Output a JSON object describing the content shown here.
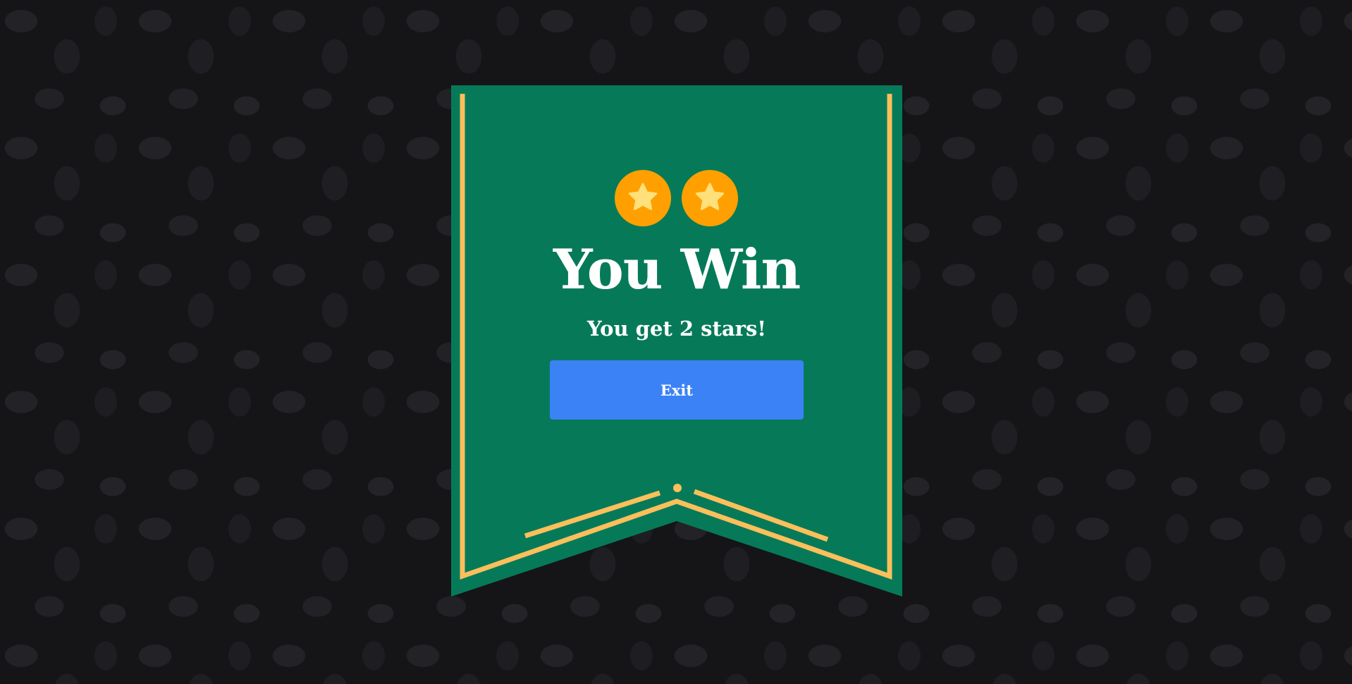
{
  "result": {
    "title": "You Win",
    "subtitle": "You get 2 stars!",
    "stars_earned": 2,
    "exit_label": "Exit"
  },
  "colors": {
    "banner": "#067a58",
    "trim": "#fbbf5b",
    "coin": "#ffa000",
    "star": "#ffe07a",
    "button": "#3b82f6"
  }
}
